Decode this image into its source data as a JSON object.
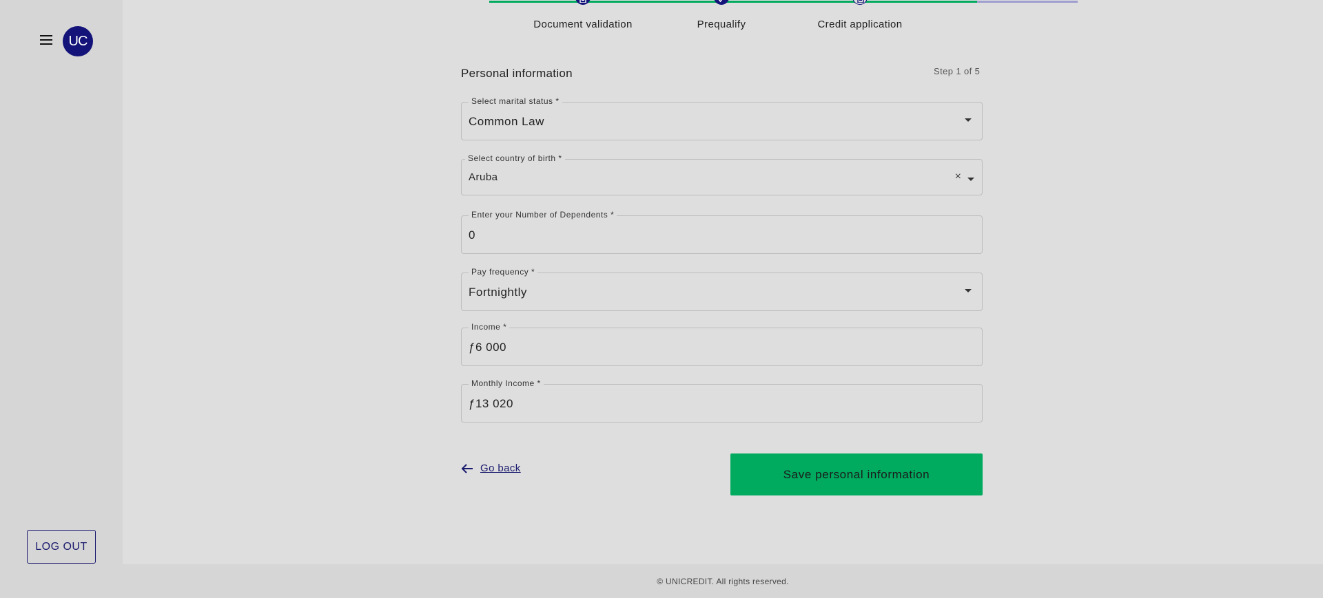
{
  "sidebar": {
    "menu_icon": "hamburger-menu-icon",
    "avatar_initials": "UC",
    "logout_label": "LOG OUT"
  },
  "stepper": {
    "steps": [
      {
        "label": "Document validation",
        "icon": "document-icon",
        "state": "complete"
      },
      {
        "label": "Prequalify",
        "icon": "checklist-icon",
        "state": "complete"
      },
      {
        "label": "Credit application",
        "icon": "document-icon",
        "state": "current"
      }
    ],
    "colors": {
      "complete": "#00aa5f",
      "pending": "#9e9ecf",
      "dot": "#13137a"
    }
  },
  "form": {
    "title": "Personal information",
    "step_indicator": "Step 1 of 5",
    "fields": {
      "marital_status": {
        "label": "Select marital status *",
        "value": "Common Law"
      },
      "country_of_birth": {
        "label": "Select country of birth *",
        "value": "Aruba"
      },
      "dependents": {
        "label": "Enter your Number of Dependents *",
        "value": "0"
      },
      "pay_frequency": {
        "label": "Pay frequency *",
        "value": "Fortnightly"
      },
      "income": {
        "label": "Income *",
        "value": "ƒ6 000"
      },
      "monthly_income": {
        "label": "Monthly Income *",
        "value": "ƒ13 020"
      }
    },
    "go_back_label": "Go back",
    "save_label": "Save personal information"
  },
  "footer": {
    "text": "© UNICREDIT. All rights reserved."
  },
  "colors": {
    "accent": "#00aa5f",
    "brand": "#13137a",
    "background": "#dedede"
  }
}
